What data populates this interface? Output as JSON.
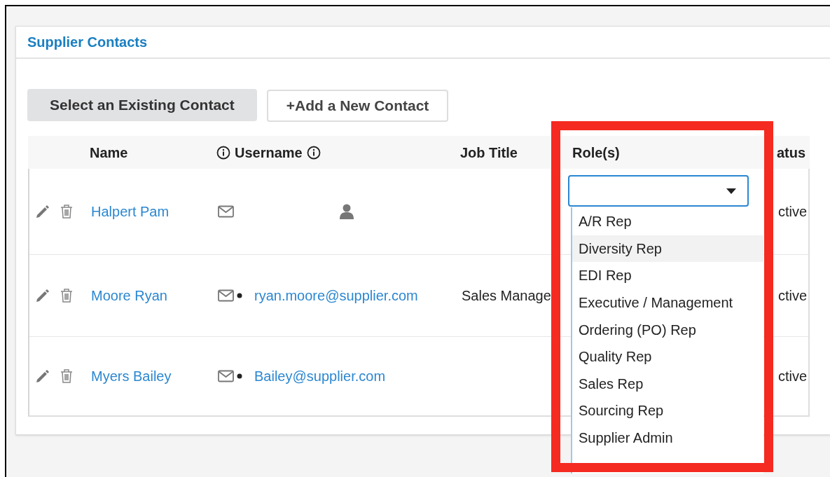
{
  "panel": {
    "title": "Supplier Contacts"
  },
  "buttons": [
    {
      "label": "Select an Existing Contact",
      "selected": true
    },
    {
      "label": "Add a New Contact",
      "selected": false,
      "icon": "+"
    }
  ],
  "table": {
    "columns": [
      "Name",
      "Username",
      "Job Title",
      "Role(s)",
      "atus"
    ],
    "rows": [
      {
        "name": "Halpert Pam",
        "email_dot": false,
        "username": null,
        "job_title": null,
        "status": "ctive"
      },
      {
        "name": "Moore Ryan",
        "email_dot": true,
        "username": "ryan.moore@supplier.com",
        "job_title": "Sales Manage",
        "status": "ctive"
      },
      {
        "name": "Myers Bailey",
        "email_dot": true,
        "username": "Bailey@supplier.com",
        "job_title": null,
        "status": "ctive"
      }
    ]
  },
  "role_dropdown": {
    "options": [
      {
        "label": "A/R Rep",
        "hovered": false
      },
      {
        "label": "Diversity Rep",
        "hovered": true
      },
      {
        "label": "EDI Rep",
        "hovered": false
      },
      {
        "label": "Executive / Management",
        "hovered": false
      },
      {
        "label": "Ordering (PO) Rep",
        "hovered": false
      },
      {
        "label": "Quality Rep",
        "hovered": false
      },
      {
        "label": "Sales Rep",
        "hovered": false
      },
      {
        "label": "Sourcing Rep",
        "hovered": false
      },
      {
        "label": "Supplier Admin",
        "hovered": false
      }
    ]
  }
}
